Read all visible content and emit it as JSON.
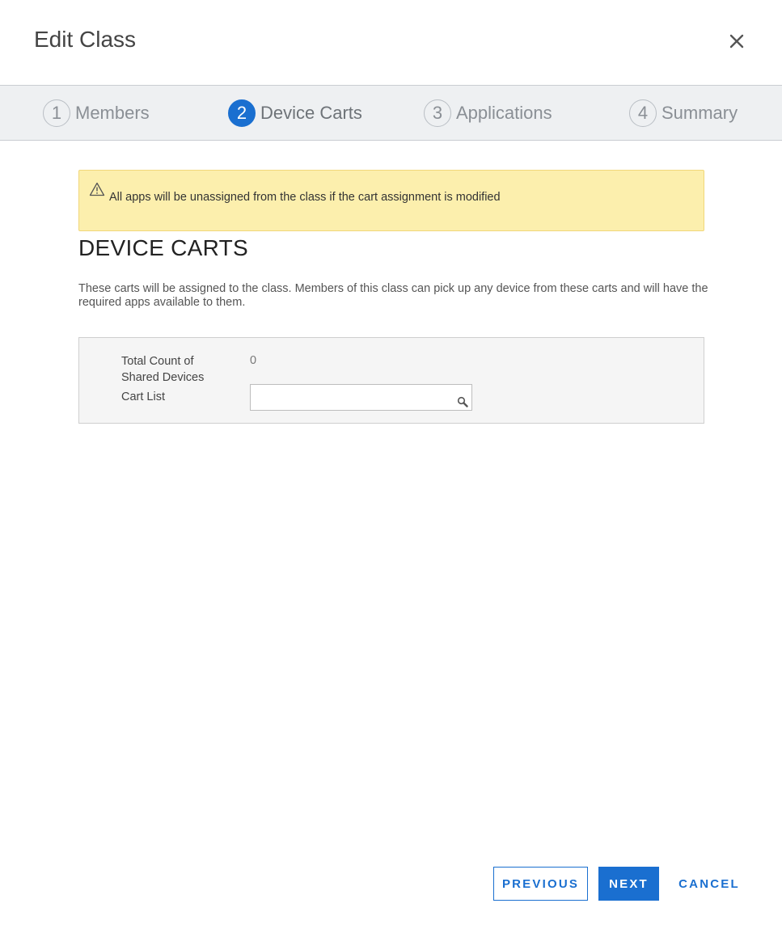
{
  "dialog": {
    "title": "Edit Class",
    "close_icon": "close-icon"
  },
  "steps": [
    {
      "number": "1",
      "label": "Members",
      "active": false
    },
    {
      "number": "2",
      "label": "Device Carts",
      "active": true
    },
    {
      "number": "3",
      "label": "Applications",
      "active": false
    },
    {
      "number": "4",
      "label": "Summary",
      "active": false
    }
  ],
  "alert": {
    "icon": "warning-icon",
    "message": "All apps will be unassigned from the class if the cart assignment is modified"
  },
  "section": {
    "title": "DEVICE CARTS",
    "description": "These carts will be assigned to the class. Members of this class can pick up any device from these carts and will have the required apps available to them."
  },
  "form": {
    "total_label_line1": "Total Count of",
    "total_label_line2": "Shared Devices",
    "total_value": "0",
    "cart_list_label": "Cart List",
    "cart_list_value": "",
    "search_icon": "search-icon"
  },
  "buttons": {
    "previous": "PREVIOUS",
    "next": "NEXT",
    "cancel": "CANCEL"
  },
  "colors": {
    "accent": "#1a6fd0",
    "alert_bg": "#fcefad",
    "alert_border": "#f1d77a",
    "stepper_bg": "#eef0f2"
  }
}
